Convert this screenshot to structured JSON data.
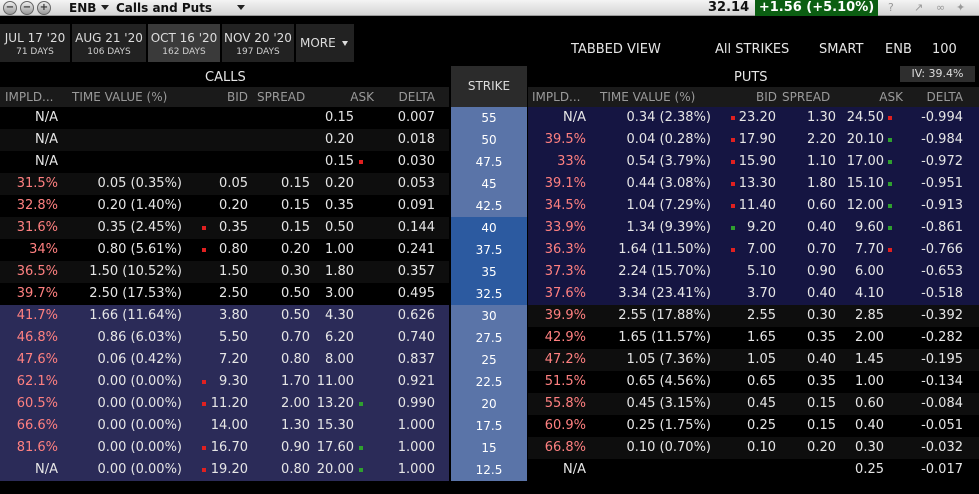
{
  "titlebar": {
    "buttons": [
      "−",
      "−",
      "+"
    ],
    "symbol": "ENB",
    "title": "Calls and Puts",
    "last_price": "32.14",
    "change": "+1.56 (+5.10%)"
  },
  "expiries": [
    {
      "date": "JUL 17 '20",
      "days": "71 DAYS"
    },
    {
      "date": "AUG 21 '20",
      "days": "106 DAYS"
    },
    {
      "date": "OCT 16 '20",
      "days": "162 DAYS",
      "active": true
    },
    {
      "date": "NOV 20 '20",
      "days": "197 DAYS"
    }
  ],
  "more_label": "MORE",
  "options": {
    "view": "TABBED VIEW",
    "strikes": "All STRIKES",
    "exchange": "SMART",
    "underlying": "ENB",
    "quantity": "100"
  },
  "iv": "IV: 39.4%",
  "calls_label": "CALLS",
  "puts_label": "PUTS",
  "strike_label": "STRIKE",
  "columns": {
    "impld": "IMPLD...",
    "time_value": "TIME VALUE (%)",
    "bid": "BID",
    "spread": "SPREAD",
    "ask": "ASK",
    "delta": "DELTA"
  },
  "colors": {
    "calls_itm": "#2b2b58",
    "puts_otm": "#151542",
    "strike_otm": "#5a74a8",
    "strike_itm": "#2c5aa0",
    "alt_row": "#0e0e0e",
    "iv_red": "#ff8080",
    "marker_red": "#e02020",
    "marker_green": "#2fa02f",
    "positive": "#0b5e12"
  },
  "rows": [
    {
      "strike": "55",
      "call": {
        "impld": "N/A",
        "tv": "",
        "bid": "",
        "spread": "",
        "ask": "0.15",
        "delta": "0.007"
      },
      "put": {
        "impld": "N/A",
        "tv": "0.34 (2.38%)",
        "bid": "23.20",
        "spread": "1.30",
        "ask": "24.50",
        "delta": "-0.994"
      },
      "call_ask_mark": "",
      "call_bid_mark": "",
      "put_bid_mark": "r",
      "put_ask_mark": "r"
    },
    {
      "strike": "50",
      "call": {
        "impld": "N/A",
        "tv": "",
        "bid": "",
        "spread": "",
        "ask": "0.20",
        "delta": "0.018"
      },
      "put": {
        "impld": "39.5%",
        "tv": "0.04 (0.28%)",
        "bid": "17.90",
        "spread": "2.20",
        "ask": "20.10",
        "delta": "-0.984"
      },
      "call_ask_mark": "",
      "call_bid_mark": "",
      "put_bid_mark": "r",
      "put_ask_mark": "g"
    },
    {
      "strike": "47.5",
      "call": {
        "impld": "N/A",
        "tv": "",
        "bid": "",
        "spread": "",
        "ask": "0.15",
        "delta": "0.030"
      },
      "put": {
        "impld": "33%",
        "tv": "0.54 (3.79%)",
        "bid": "15.90",
        "spread": "1.10",
        "ask": "17.00",
        "delta": "-0.972"
      },
      "call_ask_mark": "r",
      "call_bid_mark": "",
      "put_bid_mark": "r",
      "put_ask_mark": "g"
    },
    {
      "strike": "45",
      "call": {
        "impld": "31.5%",
        "tv": "0.05 (0.35%)",
        "bid": "0.05",
        "spread": "0.15",
        "ask": "0.20",
        "delta": "0.053"
      },
      "put": {
        "impld": "39.1%",
        "tv": "0.44 (3.08%)",
        "bid": "13.30",
        "spread": "1.80",
        "ask": "15.10",
        "delta": "-0.951"
      },
      "call_ask_mark": "",
      "call_bid_mark": "",
      "put_bid_mark": "r",
      "put_ask_mark": "g"
    },
    {
      "strike": "42.5",
      "call": {
        "impld": "32.8%",
        "tv": "0.20 (1.40%)",
        "bid": "0.20",
        "spread": "0.15",
        "ask": "0.35",
        "delta": "0.091"
      },
      "put": {
        "impld": "34.5%",
        "tv": "1.04 (7.29%)",
        "bid": "11.40",
        "spread": "0.60",
        "ask": "12.00",
        "delta": "-0.913"
      },
      "call_ask_mark": "",
      "call_bid_mark": "",
      "put_bid_mark": "r",
      "put_ask_mark": "g"
    },
    {
      "strike": "40",
      "call": {
        "impld": "31.6%",
        "tv": "0.35 (2.45%)",
        "bid": "0.35",
        "spread": "0.15",
        "ask": "0.50",
        "delta": "0.144"
      },
      "put": {
        "impld": "33.9%",
        "tv": "1.34 (9.39%)",
        "bid": "9.20",
        "spread": "0.40",
        "ask": "9.60",
        "delta": "-0.861"
      },
      "call_ask_mark": "",
      "call_bid_mark": "r",
      "put_bid_mark": "g",
      "put_ask_mark": "g"
    },
    {
      "strike": "37.5",
      "call": {
        "impld": "34%",
        "tv": "0.80 (5.61%)",
        "bid": "0.80",
        "spread": "0.20",
        "ask": "1.00",
        "delta": "0.241"
      },
      "put": {
        "impld": "36.3%",
        "tv": "1.64 (11.50%)",
        "bid": "7.00",
        "spread": "0.70",
        "ask": "7.70",
        "delta": "-0.766"
      },
      "call_ask_mark": "",
      "call_bid_mark": "r",
      "put_bid_mark": "r",
      "put_ask_mark": "r"
    },
    {
      "strike": "35",
      "call": {
        "impld": "36.5%",
        "tv": "1.50 (10.52%)",
        "bid": "1.50",
        "spread": "0.30",
        "ask": "1.80",
        "delta": "0.357"
      },
      "put": {
        "impld": "37.3%",
        "tv": "2.24 (15.70%)",
        "bid": "5.10",
        "spread": "0.90",
        "ask": "6.00",
        "delta": "-0.653"
      },
      "call_ask_mark": "",
      "call_bid_mark": "",
      "put_bid_mark": "",
      "put_ask_mark": ""
    },
    {
      "strike": "32.5",
      "call": {
        "impld": "39.7%",
        "tv": "2.50 (17.53%)",
        "bid": "2.50",
        "spread": "0.50",
        "ask": "3.00",
        "delta": "0.495"
      },
      "put": {
        "impld": "37.6%",
        "tv": "3.34 (23.41%)",
        "bid": "3.70",
        "spread": "0.40",
        "ask": "4.10",
        "delta": "-0.518"
      },
      "call_ask_mark": "",
      "call_bid_mark": "",
      "put_bid_mark": "",
      "put_ask_mark": ""
    },
    {
      "strike": "30",
      "call": {
        "impld": "41.7%",
        "tv": "1.66 (11.64%)",
        "bid": "3.80",
        "spread": "0.50",
        "ask": "4.30",
        "delta": "0.626"
      },
      "put": {
        "impld": "39.9%",
        "tv": "2.55 (17.88%)",
        "bid": "2.55",
        "spread": "0.30",
        "ask": "2.85",
        "delta": "-0.392"
      },
      "call_ask_mark": "",
      "call_bid_mark": "",
      "put_bid_mark": "",
      "put_ask_mark": ""
    },
    {
      "strike": "27.5",
      "call": {
        "impld": "46.8%",
        "tv": "0.86 (6.03%)",
        "bid": "5.50",
        "spread": "0.70",
        "ask": "6.20",
        "delta": "0.740"
      },
      "put": {
        "impld": "42.9%",
        "tv": "1.65 (11.57%)",
        "bid": "1.65",
        "spread": "0.35",
        "ask": "2.00",
        "delta": "-0.282"
      },
      "call_ask_mark": "",
      "call_bid_mark": "",
      "put_bid_mark": "",
      "put_ask_mark": ""
    },
    {
      "strike": "25",
      "call": {
        "impld": "47.6%",
        "tv": "0.06 (0.42%)",
        "bid": "7.20",
        "spread": "0.80",
        "ask": "8.00",
        "delta": "0.837"
      },
      "put": {
        "impld": "47.2%",
        "tv": "1.05 (7.36%)",
        "bid": "1.05",
        "spread": "0.40",
        "ask": "1.45",
        "delta": "-0.195"
      },
      "call_ask_mark": "",
      "call_bid_mark": "",
      "put_bid_mark": "",
      "put_ask_mark": ""
    },
    {
      "strike": "22.5",
      "call": {
        "impld": "62.1%",
        "tv": "0.00 (0.00%)",
        "bid": "9.30",
        "spread": "1.70",
        "ask": "11.00",
        "delta": "0.921"
      },
      "put": {
        "impld": "51.5%",
        "tv": "0.65 (4.56%)",
        "bid": "0.65",
        "spread": "0.35",
        "ask": "1.00",
        "delta": "-0.134"
      },
      "call_ask_mark": "",
      "call_bid_mark": "r",
      "put_bid_mark": "",
      "put_ask_mark": ""
    },
    {
      "strike": "20",
      "call": {
        "impld": "60.5%",
        "tv": "0.00 (0.00%)",
        "bid": "11.20",
        "spread": "2.00",
        "ask": "13.20",
        "delta": "0.990"
      },
      "put": {
        "impld": "55.8%",
        "tv": "0.45 (3.15%)",
        "bid": "0.45",
        "spread": "0.15",
        "ask": "0.60",
        "delta": "-0.084"
      },
      "call_ask_mark": "g",
      "call_bid_mark": "r",
      "put_bid_mark": "",
      "put_ask_mark": ""
    },
    {
      "strike": "17.5",
      "call": {
        "impld": "66.6%",
        "tv": "0.00 (0.00%)",
        "bid": "14.00",
        "spread": "1.30",
        "ask": "15.30",
        "delta": "1.000"
      },
      "put": {
        "impld": "60.9%",
        "tv": "0.25 (1.75%)",
        "bid": "0.25",
        "spread": "0.15",
        "ask": "0.40",
        "delta": "-0.051"
      },
      "call_ask_mark": "",
      "call_bid_mark": "",
      "put_bid_mark": "",
      "put_ask_mark": ""
    },
    {
      "strike": "15",
      "call": {
        "impld": "81.6%",
        "tv": "0.00 (0.00%)",
        "bid": "16.70",
        "spread": "0.90",
        "ask": "17.60",
        "delta": "1.000"
      },
      "put": {
        "impld": "66.8%",
        "tv": "0.10 (0.70%)",
        "bid": "0.10",
        "spread": "0.20",
        "ask": "0.30",
        "delta": "-0.032"
      },
      "call_ask_mark": "g",
      "call_bid_mark": "r",
      "put_bid_mark": "",
      "put_ask_mark": ""
    },
    {
      "strike": "12.5",
      "call": {
        "impld": "N/A",
        "tv": "0.00 (0.00%)",
        "bid": "19.20",
        "spread": "0.80",
        "ask": "20.00",
        "delta": "1.000"
      },
      "put": {
        "impld": "N/A",
        "tv": "",
        "bid": "",
        "spread": "",
        "ask": "0.25",
        "delta": "-0.017"
      },
      "call_ask_mark": "g",
      "call_bid_mark": "r",
      "put_bid_mark": "",
      "put_ask_mark": ""
    }
  ]
}
